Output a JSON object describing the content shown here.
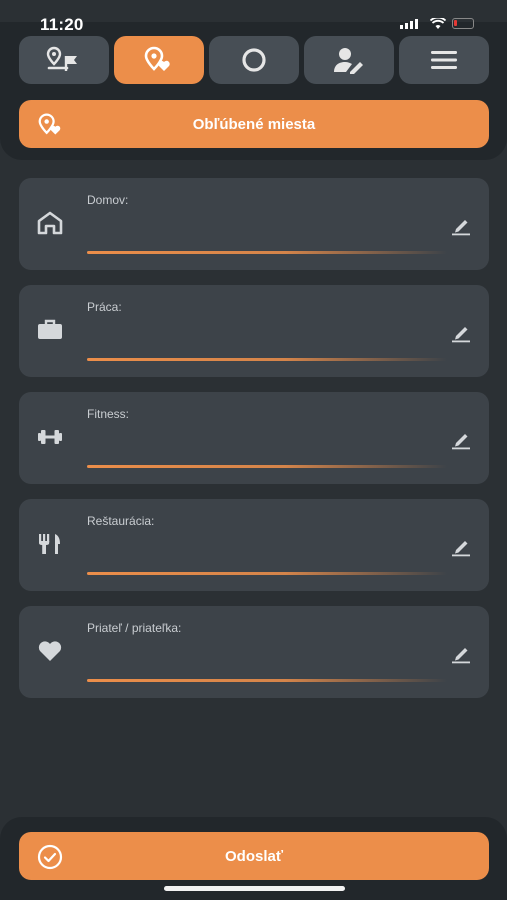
{
  "status_bar": {
    "time": "11:20"
  },
  "tabs": [
    {
      "icon": "route-flag-icon",
      "active": false
    },
    {
      "icon": "favorite-place-icon",
      "active": true
    },
    {
      "icon": "circle-icon",
      "active": false
    },
    {
      "icon": "user-edit-icon",
      "active": false
    },
    {
      "icon": "hamburger-menu-icon",
      "active": false
    }
  ],
  "header": {
    "title": "Obľúbené miesta",
    "icon": "favorite-place-icon"
  },
  "places": [
    {
      "label": "Domov:",
      "value": "",
      "icon": "home-icon"
    },
    {
      "label": "Práca:",
      "value": "",
      "icon": "briefcase-icon"
    },
    {
      "label": "Fitness:",
      "value": "",
      "icon": "dumbbell-icon"
    },
    {
      "label": "Reštaurácia:",
      "value": "",
      "icon": "fork-knife-icon"
    },
    {
      "label": "Priateľ / priateľka:",
      "value": "",
      "icon": "heart-icon"
    }
  ],
  "footer": {
    "submit_label": "Odoslať",
    "icon": "check-circle-icon"
  },
  "colors": {
    "accent": "#ec8e4a",
    "background": "#2b3034",
    "card": "#3d4349",
    "tab": "#474e55",
    "panel": "#22272b"
  }
}
